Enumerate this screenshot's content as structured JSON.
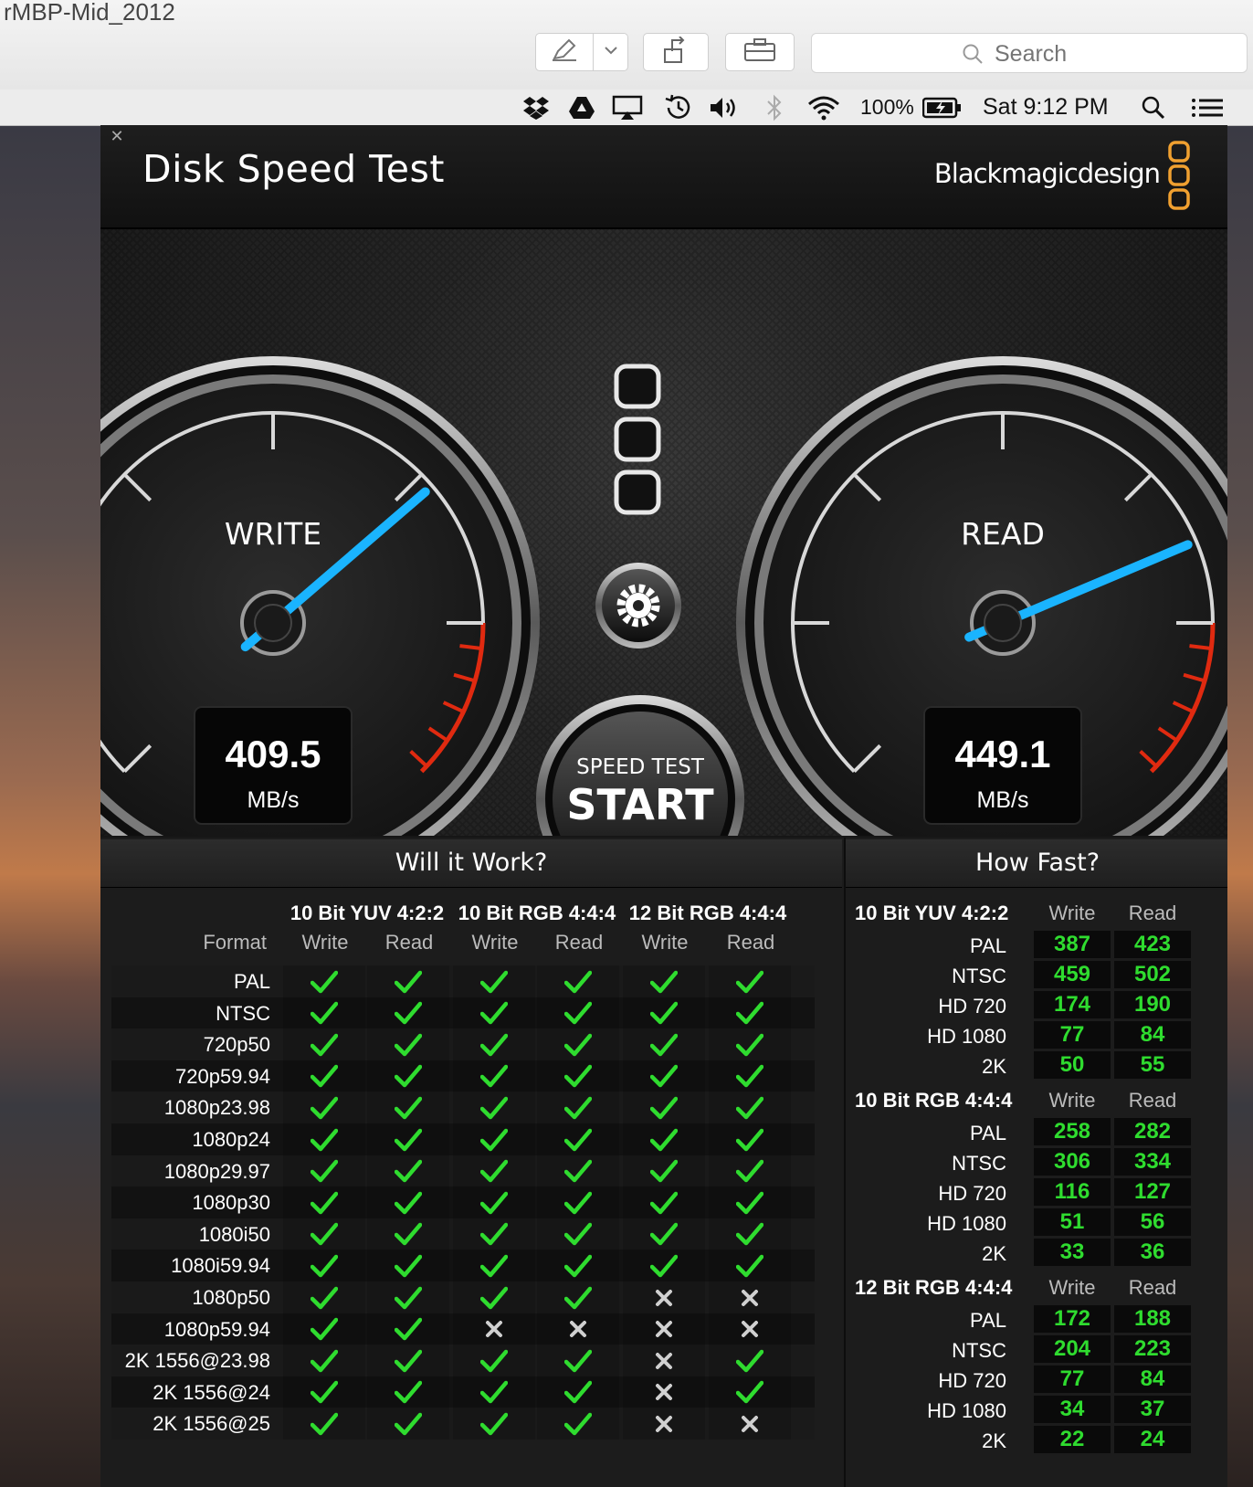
{
  "window": {
    "title": "rMBP-Mid_2012"
  },
  "toolbar": {
    "search_placeholder": "Search"
  },
  "menubar": {
    "battery": "100%",
    "clock": "Sat 9:12 PM"
  },
  "app": {
    "title": "Disk Speed Test",
    "brand": "Blackmagicdesign"
  },
  "gauges": {
    "write": {
      "label": "WRITE",
      "value": "409.5",
      "unit": "MB/s"
    },
    "read": {
      "label": "READ",
      "value": "449.1",
      "unit": "MB/s"
    }
  },
  "start": {
    "line1": "SPEED TEST",
    "line2": "START"
  },
  "will_it_work": {
    "title": "Will it Work?",
    "format_label": "Format",
    "groups": [
      "10 Bit YUV 4:2:2",
      "10 Bit RGB 4:4:4",
      "12 Bit RGB 4:4:4"
    ],
    "sub": [
      "Write",
      "Read",
      "Write",
      "Read",
      "Write",
      "Read"
    ],
    "rows": [
      {
        "format": "PAL",
        "ok": [
          1,
          1,
          1,
          1,
          1,
          1
        ]
      },
      {
        "format": "NTSC",
        "ok": [
          1,
          1,
          1,
          1,
          1,
          1
        ]
      },
      {
        "format": "720p50",
        "ok": [
          1,
          1,
          1,
          1,
          1,
          1
        ]
      },
      {
        "format": "720p59.94",
        "ok": [
          1,
          1,
          1,
          1,
          1,
          1
        ]
      },
      {
        "format": "1080p23.98",
        "ok": [
          1,
          1,
          1,
          1,
          1,
          1
        ]
      },
      {
        "format": "1080p24",
        "ok": [
          1,
          1,
          1,
          1,
          1,
          1
        ]
      },
      {
        "format": "1080p29.97",
        "ok": [
          1,
          1,
          1,
          1,
          1,
          1
        ]
      },
      {
        "format": "1080p30",
        "ok": [
          1,
          1,
          1,
          1,
          1,
          1
        ]
      },
      {
        "format": "1080i50",
        "ok": [
          1,
          1,
          1,
          1,
          1,
          1
        ]
      },
      {
        "format": "1080i59.94",
        "ok": [
          1,
          1,
          1,
          1,
          1,
          1
        ]
      },
      {
        "format": "1080p50",
        "ok": [
          1,
          1,
          1,
          1,
          0,
          0
        ]
      },
      {
        "format": "1080p59.94",
        "ok": [
          1,
          1,
          0,
          0,
          0,
          0
        ]
      },
      {
        "format": "2K 1556@23.98",
        "ok": [
          1,
          1,
          1,
          1,
          0,
          1
        ]
      },
      {
        "format": "2K 1556@24",
        "ok": [
          1,
          1,
          1,
          1,
          0,
          1
        ]
      },
      {
        "format": "2K 1556@25",
        "ok": [
          1,
          1,
          1,
          1,
          0,
          0
        ]
      }
    ]
  },
  "how_fast": {
    "title": "How Fast?",
    "write_label": "Write",
    "read_label": "Read",
    "sections": [
      {
        "name": "10 Bit YUV 4:2:2",
        "rows": [
          {
            "format": "PAL",
            "write": "387",
            "read": "423"
          },
          {
            "format": "NTSC",
            "write": "459",
            "read": "502"
          },
          {
            "format": "HD 720",
            "write": "174",
            "read": "190"
          },
          {
            "format": "HD 1080",
            "write": "77",
            "read": "84"
          },
          {
            "format": "2K",
            "write": "50",
            "read": "55"
          }
        ]
      },
      {
        "name": "10 Bit RGB 4:4:4",
        "rows": [
          {
            "format": "PAL",
            "write": "258",
            "read": "282"
          },
          {
            "format": "NTSC",
            "write": "306",
            "read": "334"
          },
          {
            "format": "HD 720",
            "write": "116",
            "read": "127"
          },
          {
            "format": "HD 1080",
            "write": "51",
            "read": "56"
          },
          {
            "format": "2K",
            "write": "33",
            "read": "36"
          }
        ]
      },
      {
        "name": "12 Bit RGB 4:4:4",
        "rows": [
          {
            "format": "PAL",
            "write": "172",
            "read": "188"
          },
          {
            "format": "NTSC",
            "write": "204",
            "read": "223"
          },
          {
            "format": "HD 720",
            "write": "77",
            "read": "84"
          },
          {
            "format": "HD 1080",
            "write": "34",
            "read": "37"
          },
          {
            "format": "2K",
            "write": "22",
            "read": "24"
          }
        ]
      }
    ]
  },
  "colors": {
    "needle": "#1ab4ff",
    "ok": "#2fdc2f",
    "redzone": "#e02a10",
    "brand_orange": "#f0a030"
  },
  "icons": [
    "pencil-icon",
    "chevron-down-icon",
    "share-icon",
    "toolbox-icon",
    "search-icon",
    "dropbox-icon",
    "google-drive-icon",
    "airplay-icon",
    "time-machine-icon",
    "volume-icon",
    "bluetooth-icon",
    "wifi-icon",
    "battery-icon",
    "spotlight-icon",
    "notification-center-icon",
    "close-icon",
    "gear-icon",
    "check-icon",
    "cross-icon"
  ]
}
